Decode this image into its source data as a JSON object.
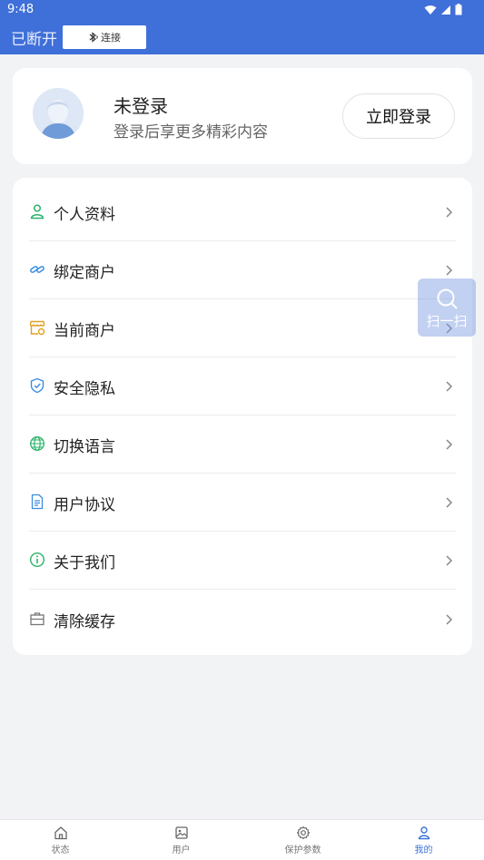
{
  "status_bar": {
    "time": "9:48"
  },
  "top_bar": {
    "connection_status": "已断开",
    "connect_button_label": "连接"
  },
  "profile": {
    "name": "未登录",
    "subtitle": "登录后享更多精彩内容",
    "login_button": "立即登录"
  },
  "menu": {
    "items": [
      {
        "label": "个人资料",
        "icon": "person-icon"
      },
      {
        "label": "绑定商户",
        "icon": "link-icon"
      },
      {
        "label": "当前商户",
        "icon": "store-icon"
      },
      {
        "label": "安全隐私",
        "icon": "shield-icon"
      },
      {
        "label": "切换语言",
        "icon": "globe-icon"
      },
      {
        "label": "用户协议",
        "icon": "document-icon"
      },
      {
        "label": "关于我们",
        "icon": "info-icon"
      },
      {
        "label": "清除缓存",
        "icon": "briefcase-icon"
      }
    ]
  },
  "scan_button": {
    "label": "扫一扫"
  },
  "bottom_nav": {
    "items": [
      {
        "label": "状态",
        "icon": "home-icon"
      },
      {
        "label": "用户",
        "icon": "image-icon"
      },
      {
        "label": "保护参数",
        "icon": "gear-icon"
      },
      {
        "label": "我的",
        "icon": "person-icon"
      }
    ],
    "active_index": 3
  },
  "colors": {
    "header_blue": "#3f6fd8",
    "active_tab": "#3b73d9",
    "icon_green": "#2bb36b",
    "icon_blue": "#3b8de0",
    "icon_orange": "#e0a020"
  }
}
